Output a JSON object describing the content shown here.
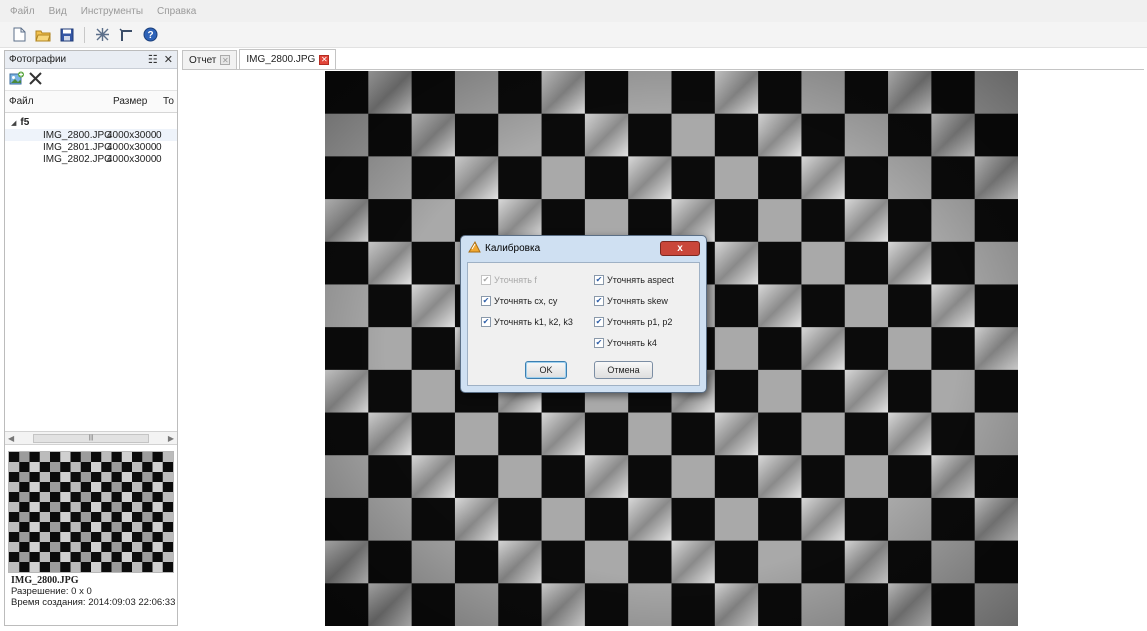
{
  "menu": [
    "Файл",
    "Вид",
    "Инструменты",
    "Справка"
  ],
  "toolbar": {
    "icons": [
      "new-file-icon",
      "open-folder-icon",
      "save-icon",
      "calibrate-icon",
      "crop-icon",
      "help-icon"
    ]
  },
  "left_panel": {
    "title": "Фотографии",
    "columns": [
      "Файл",
      "Размер",
      "То"
    ],
    "folder": "f5",
    "files": [
      {
        "name": "IMG_2800.JPG",
        "size": "4000x3000",
        "points": "0"
      },
      {
        "name": "IMG_2801.JPG",
        "size": "4000x3000",
        "points": "0"
      },
      {
        "name": "IMG_2802.JPG",
        "size": "4000x3000",
        "points": "0"
      }
    ],
    "info": {
      "filename": "IMG_2800.JPG",
      "resolution": "Разрешение: 0 x 0",
      "created": "Время создания: 2014:09:03 22:06:33"
    }
  },
  "tabs": [
    {
      "label": "Отчет",
      "active": false
    },
    {
      "label": "IMG_2800.JPG",
      "active": true
    }
  ],
  "dialog": {
    "title": "Калибровка",
    "close_label": "x",
    "options": {
      "refine_f": {
        "label": "Уточнять f",
        "checked": true,
        "enabled": false
      },
      "refine_aspect": {
        "label": "Уточнять aspect",
        "checked": true,
        "enabled": true
      },
      "refine_cx_cy": {
        "label": "Уточнять cx, cy",
        "checked": true,
        "enabled": true
      },
      "refine_skew": {
        "label": "Уточнять skew",
        "checked": true,
        "enabled": true
      },
      "refine_k123": {
        "label": "Уточнять k1, k2, k3",
        "checked": true,
        "enabled": true
      },
      "refine_p12": {
        "label": "Уточнять p1, p2",
        "checked": true,
        "enabled": true
      },
      "refine_k4": {
        "label": "Уточнять k4",
        "checked": true,
        "enabled": true
      }
    },
    "ok_label": "OK",
    "cancel_label": "Отмена"
  },
  "colors": {
    "dialog_close": "#c9463a",
    "tab_close_active": "#e2463a",
    "checkmark": "#2f5fa8"
  }
}
